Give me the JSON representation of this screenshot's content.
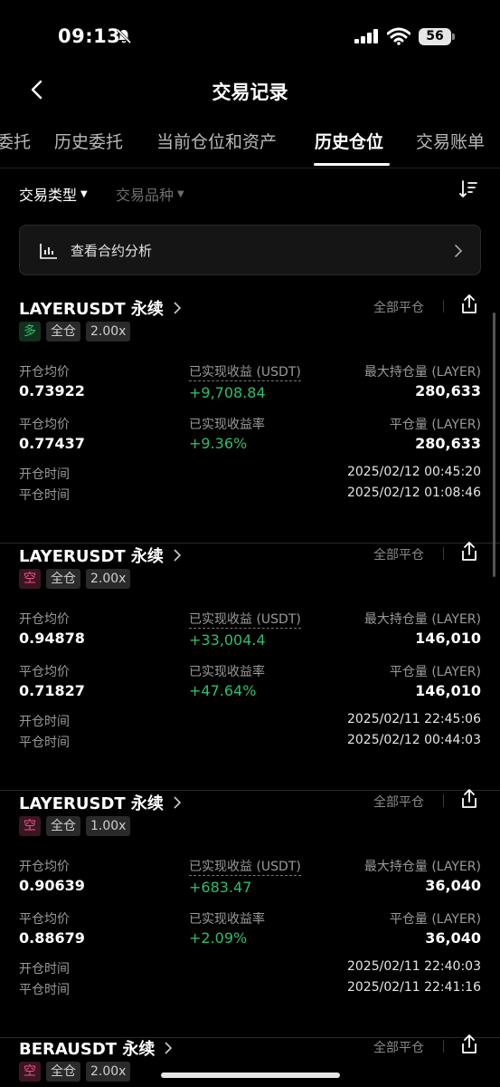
{
  "status": {
    "time": "09:13",
    "battery": "56"
  },
  "header": {
    "title": "交易记录"
  },
  "tabs": [
    {
      "label": "委托"
    },
    {
      "label": "历史委托"
    },
    {
      "label": "当前仓位和资产"
    },
    {
      "label": "历史仓位"
    },
    {
      "label": "交易账单"
    }
  ],
  "filters": {
    "type": "交易类型",
    "symbol": "交易品种"
  },
  "analysis": {
    "label": "查看合约分析"
  },
  "labels": {
    "close_all": "全部平仓",
    "open_avg": "开仓均价",
    "close_avg": "平仓均价",
    "realized_pnl": "已实现收益 (USDT)",
    "realized_rate": "已实现收益率",
    "max_hold": "最大持仓量 (LAYER)",
    "closed_qty": "平仓量 (LAYER)",
    "open_time": "开仓时间",
    "close_time": "平仓时间"
  },
  "positions": [
    {
      "symbol": "LAYERUSDT 永续",
      "side": "多",
      "margin": "全仓",
      "leverage": "2.00x",
      "open_avg": "0.73922",
      "close_avg": "0.77437",
      "pnl": "+9,708.84",
      "rate": "+9.36%",
      "max_hold": "280,633",
      "closed_qty": "280,633",
      "open_time": "2025/02/12 00:45:20",
      "close_time": "2025/02/12 01:08:46"
    },
    {
      "symbol": "LAYERUSDT 永续",
      "side": "空",
      "margin": "全仓",
      "leverage": "2.00x",
      "open_avg": "0.94878",
      "close_avg": "0.71827",
      "pnl": "+33,004.4",
      "rate": "+47.64%",
      "max_hold": "146,010",
      "closed_qty": "146,010",
      "open_time": "2025/02/11 22:45:06",
      "close_time": "2025/02/12 00:44:03"
    },
    {
      "symbol": "LAYERUSDT 永续",
      "side": "空",
      "margin": "全仓",
      "leverage": "1.00x",
      "open_avg": "0.90639",
      "close_avg": "0.88679",
      "pnl": "+683.47",
      "rate": "+2.09%",
      "max_hold": "36,040",
      "closed_qty": "36,040",
      "open_time": "2025/02/11 22:40:03",
      "close_time": "2025/02/11 22:41:16"
    },
    {
      "symbol": "BERAUSDT 永续",
      "side": "空",
      "margin": "全仓",
      "leverage": "2.00x"
    }
  ],
  "colors": {
    "long": "#2ebd6b",
    "short": "#f0507a",
    "profit": "#2ebd6b"
  }
}
